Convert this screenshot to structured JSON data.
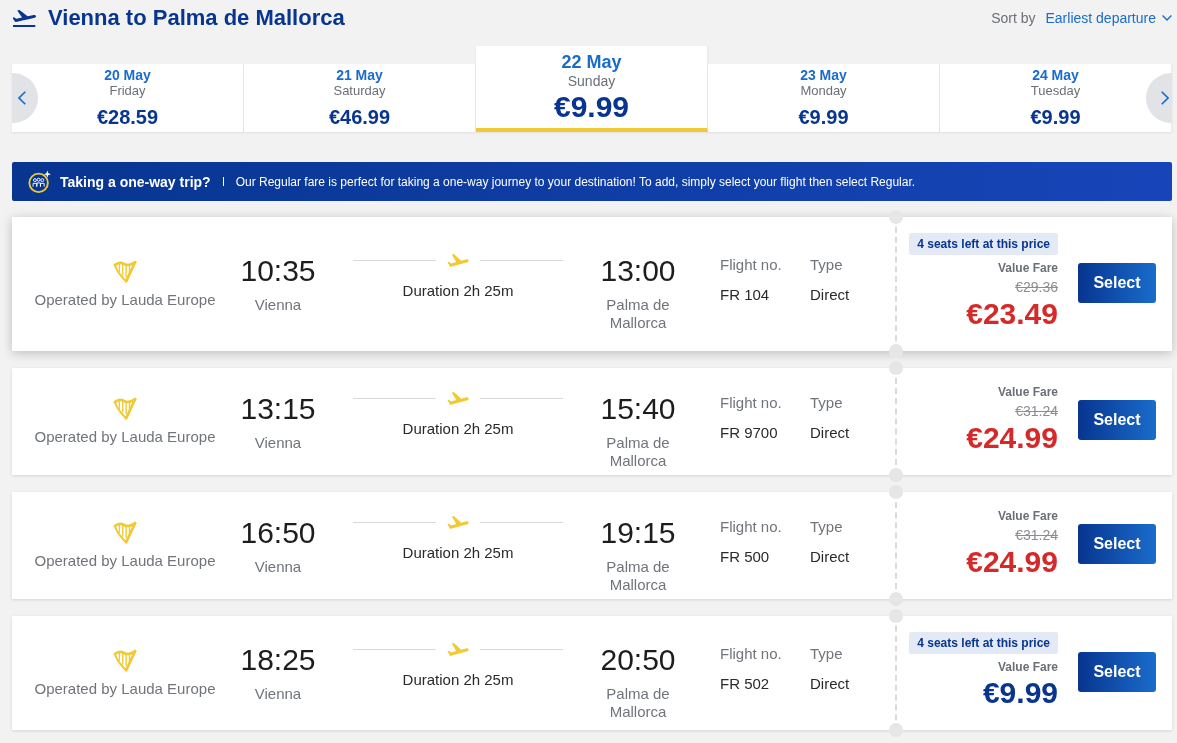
{
  "header": {
    "title": "Vienna to Palma de Mallorca",
    "sort_label": "Sort by",
    "sort_value": "Earliest departure"
  },
  "dates": [
    {
      "date": "20 May",
      "weekday": "Friday",
      "price": "€28.59",
      "selected": false
    },
    {
      "date": "21 May",
      "weekday": "Saturday",
      "price": "€46.99",
      "selected": false
    },
    {
      "date": "22 May",
      "weekday": "Sunday",
      "price": "€9.99",
      "selected": true
    },
    {
      "date": "23 May",
      "weekday": "Monday",
      "price": "€9.99",
      "selected": false
    },
    {
      "date": "24 May",
      "weekday": "Tuesday",
      "price": "€9.99",
      "selected": false
    }
  ],
  "banner": {
    "title": "Taking a one-way trip?",
    "text": "Our Regular fare is perfect for taking a one-way journey to your destination! To add, simply select your flight then select Regular."
  },
  "flights": [
    {
      "operator": "Operated by Lauda Europe",
      "depart_time": "10:35",
      "depart_city": "Vienna",
      "duration": "Duration 2h 25m",
      "arrive_time": "13:00",
      "arrive_city": "Palma de Mallorca",
      "flight_no_label": "Flight no.",
      "flight_no": "FR 104",
      "type_label": "Type",
      "type": "Direct",
      "seats_badge": "4 seats left at this price",
      "fare_name": "Value Fare",
      "original_price": "€29.36",
      "price": "€23.49",
      "discounted": true,
      "hovered": true,
      "button": "Select"
    },
    {
      "operator": "Operated by Lauda Europe",
      "depart_time": "13:15",
      "depart_city": "Vienna",
      "duration": "Duration 2h 25m",
      "arrive_time": "15:40",
      "arrive_city": "Palma de Mallorca",
      "flight_no_label": "Flight no.",
      "flight_no": "FR 9700",
      "type_label": "Type",
      "type": "Direct",
      "fare_name": "Value Fare",
      "original_price": "€31.24",
      "price": "€24.99",
      "discounted": true,
      "hovered": false,
      "button": "Select"
    },
    {
      "operator": "Operated by Lauda Europe",
      "depart_time": "16:50",
      "depart_city": "Vienna",
      "duration": "Duration 2h 25m",
      "arrive_time": "19:15",
      "arrive_city": "Palma de Mallorca",
      "flight_no_label": "Flight no.",
      "flight_no": "FR 500",
      "type_label": "Type",
      "type": "Direct",
      "fare_name": "Value Fare",
      "original_price": "€31.24",
      "price": "€24.99",
      "discounted": true,
      "hovered": false,
      "button": "Select"
    },
    {
      "operator": "Operated by Lauda Europe",
      "depart_time": "18:25",
      "depart_city": "Vienna",
      "duration": "Duration 2h 25m",
      "arrive_time": "20:50",
      "arrive_city": "Palma de Mallorca",
      "flight_no_label": "Flight no.",
      "flight_no": "FR 502",
      "type_label": "Type",
      "type": "Direct",
      "seats_badge": "4 seats left at this price",
      "fare_name": "Value Fare",
      "price": "€9.99",
      "discounted": false,
      "hovered": false,
      "button": "Select"
    }
  ]
}
